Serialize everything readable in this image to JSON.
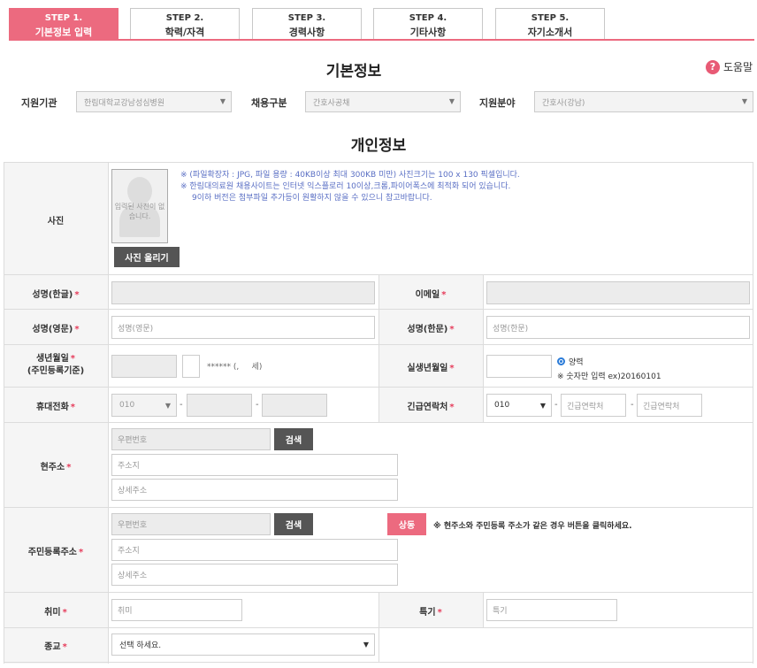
{
  "tabs": [
    {
      "step": "STEP 1.",
      "label": "기본정보 입력"
    },
    {
      "step": "STEP 2.",
      "label": "학력/자격"
    },
    {
      "step": "STEP 3.",
      "label": "경력사항"
    },
    {
      "step": "STEP 4.",
      "label": "기타사항"
    },
    {
      "step": "STEP 5.",
      "label": "자기소개서"
    }
  ],
  "basic": {
    "title": "기본정보",
    "help": "도움말",
    "help_icon": "?",
    "org_label": "지원기관",
    "org_value": "한림대학교강남성심병원",
    "hire_label": "채용구분",
    "hire_value": "간호사공채",
    "field_label": "지원분야",
    "field_value": "간호사(강남)"
  },
  "personal": {
    "title": "개인정보",
    "photo_label": "사진",
    "photo_placeholder": "입력된 사진이 없습니다.",
    "photo_button": "사진 올리기",
    "notes": [
      "※ (파일확장자 : JPG, 파일 용량 : 40KB이상 최대 300KB 미만) 사진크기는 100 x 130 픽셀입니다.",
      "※ 한림대의료원 채용사이트는 인터넷 익스플로러 10이상,크롬,파이어폭스에 최적화 되어 있습니다.",
      "9이하 버전은 첨부파일 추가등이 원활하지 않을 수 있으니 참고바랍니다."
    ],
    "name_kr_label": "성명(한글)",
    "email_label": "이메일",
    "name_en_label": "성명(영문)",
    "name_en_placeholder": "성명(영문)",
    "name_cn_label": "성명(한문)",
    "name_cn_placeholder": "성명(한문)",
    "birth_label": "생년월일",
    "birth_sub": "(주민등록기준)",
    "birth_mask": "****** (,     세)",
    "real_birth_label": "실생년월일",
    "radio_label": "양력",
    "birth_hint": "※ 숫자만 입력 ex)20160101",
    "mobile_label": "휴대전화",
    "mobile_prefix": "010",
    "emergency_label": "긴급연락처",
    "emergency_prefix": "010",
    "emergency_placeholder": "긴급연락처",
    "addr_label": "현주소",
    "zip_placeholder": "우편번호",
    "search_button": "검색",
    "addr1_placeholder": "주소지",
    "addr2_placeholder": "상세주소",
    "reg_addr_label": "주민등록주소",
    "same_button": "상동",
    "same_note": "※ 현주소와 주민등록 주소가 같은 경우 버튼을 클릭하세요.",
    "hobby_label": "취미",
    "hobby_placeholder": "취미",
    "skill_label": "특기",
    "skill_placeholder": "특기",
    "religion_label": "종교",
    "religion_value": "선택 하세요.",
    "dash": "-"
  }
}
